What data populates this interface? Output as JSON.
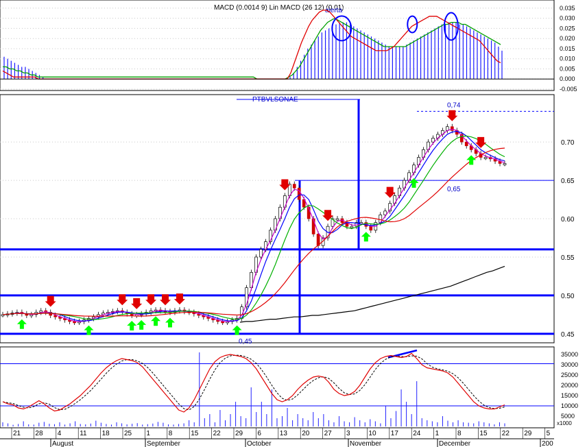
{
  "colors": {
    "background": "#ffffff",
    "grid": "#c8c8c8",
    "axis": "#000000",
    "level_line": "#0000ff",
    "ma_fast": "#c800c8",
    "ma_mid": "#0000ff",
    "ma_slow": "#00b000",
    "ma_long": "#e00000",
    "ma_200": "#000000",
    "signal_down": "#e00000",
    "signal_up": "#00ff00",
    "annotation": "#0000c8",
    "macd_hist": "#1a1aff",
    "macd_signal": "#00a000",
    "macd_line": "#e00000",
    "stoch_k": "#e00000",
    "stoch_d": "#000000",
    "volume": "#2020ff"
  },
  "macd_panel": {
    "title": "MACD (0.0014 9) Lin MACD (26 12) (0.01)",
    "label": "alerta",
    "y_ticks": [
      "0.035",
      "0.030",
      "0.025",
      "0.020",
      "0.015",
      "0.010",
      "0.005",
      "0.000",
      "-0.005"
    ]
  },
  "price_panel": {
    "title": "PTBVLSONAE",
    "y_ticks": [
      "0.70",
      "0.65",
      "0.60",
      "0.55",
      "0.50",
      "0.45"
    ],
    "annotations": [
      "0,74",
      "0,65",
      "0,45"
    ]
  },
  "osc_panel": {
    "y_ticks": [
      "35000",
      "30000",
      "25000",
      "20000",
      "15000",
      "10000",
      "5000"
    ],
    "unit": "x1000"
  },
  "x_axis": {
    "day_ticks": [
      "21",
      "28",
      "4",
      "11",
      "18",
      "25",
      "1",
      "8",
      "15",
      "22",
      "29",
      "6",
      "13",
      "20",
      "27",
      "3",
      "10",
      "17",
      "24",
      "1",
      "8",
      "15",
      "22",
      "29",
      "5"
    ],
    "months": [
      "August",
      "September",
      "October",
      "November",
      "December",
      "200"
    ]
  },
  "chart_data": [
    {
      "type": "bar",
      "name": "MACD",
      "ylim": [
        -0.005,
        0.037
      ],
      "histogram": [
        0.011,
        0.01,
        0.009,
        0.008,
        0.007,
        0.006,
        0.006,
        0.005,
        0.004,
        0.003,
        0.002,
        0.001,
        0.0,
        0.0,
        0.0,
        0.0,
        0.0,
        0.0,
        0.0,
        0.0,
        0.0,
        0.0,
        0.0,
        0.0,
        0.0,
        0.0,
        0.0,
        0.0,
        0.0,
        0.0,
        0.0,
        0.0,
        0.0,
        0.0,
        0.0,
        0.0,
        0.0,
        0.0,
        0.0,
        0.0,
        0.0,
        0.0,
        0.0,
        0.0,
        0.0,
        0.0,
        0.0,
        0.0,
        0.0,
        0.0,
        0.0,
        0.0,
        0.0,
        0.0,
        0.0,
        0.0,
        0.0,
        0.0,
        0.0,
        0.0,
        0.0,
        0.0,
        0.0,
        0.0,
        0.0,
        0.0,
        0.0,
        0.0,
        0.0,
        0.0,
        0.0,
        0.0,
        0.0,
        0.0,
        0.0,
        0.0,
        0.0,
        0.0,
        0.0,
        0.0,
        0.0,
        0.001,
        0.003,
        0.006,
        0.009,
        0.012,
        0.015,
        0.017,
        0.019,
        0.021,
        0.023,
        0.024,
        0.025,
        0.026,
        0.027,
        0.028,
        0.028,
        0.028,
        0.027,
        0.026,
        0.025,
        0.024,
        0.023,
        0.022,
        0.021,
        0.02,
        0.019,
        0.018,
        0.017,
        0.016,
        0.016,
        0.016,
        0.016,
        0.016,
        0.017,
        0.018,
        0.019,
        0.02,
        0.021,
        0.022,
        0.023,
        0.024,
        0.025,
        0.026,
        0.027,
        0.027,
        0.028,
        0.028,
        0.028,
        0.027,
        0.027,
        0.026,
        0.025,
        0.024,
        0.023,
        0.022,
        0.021,
        0.02,
        0.019,
        0.018,
        0.016,
        0.014
      ],
      "signal": [
        0.006,
        0.006,
        0.005,
        0.005,
        0.004,
        0.004,
        0.003,
        0.003,
        0.002,
        0.002,
        0.001,
        0.001,
        0.001,
        0.001,
        0.001,
        0.001,
        0.001,
        0.001,
        0.001,
        0.001,
        0.001,
        0.001,
        0.001,
        0.001,
        0.001,
        0.001,
        0.001,
        0.001,
        0.001,
        0.001,
        0.001,
        0.001,
        0.001,
        0.001,
        0.001,
        0.001,
        0.001,
        0.001,
        0.001,
        0.001,
        0.001,
        0.001,
        0.001,
        0.001,
        0.001,
        0.001,
        0.001,
        0.001,
        0.001,
        0.001,
        0.001,
        0.001,
        0.001,
        0.001,
        0.001,
        0.001,
        0.001,
        0.001,
        0.001,
        0.001,
        0.001,
        0.001,
        0.001,
        0.001,
        0.001,
        0.001,
        0.001,
        0.001,
        0.001,
        0.001,
        0.001,
        0.001,
        0.0,
        0.0,
        0.0,
        0.0,
        0.0,
        0.0,
        0.0,
        0.0,
        0.0,
        0.001,
        0.002,
        0.004,
        0.006,
        0.009,
        0.012,
        0.015,
        0.018,
        0.021,
        0.024,
        0.026,
        0.028,
        0.029,
        0.03,
        0.029,
        0.028,
        0.027,
        0.026,
        0.025,
        0.024,
        0.023,
        0.022,
        0.021,
        0.02,
        0.019,
        0.018,
        0.017,
        0.016,
        0.016,
        0.016,
        0.016,
        0.016,
        0.016,
        0.016,
        0.017,
        0.018,
        0.019,
        0.02,
        0.021,
        0.022,
        0.023,
        0.024,
        0.025,
        0.026,
        0.027,
        0.027,
        0.028,
        0.028,
        0.028,
        0.027,
        0.027,
        0.026,
        0.025,
        0.024,
        0.023,
        0.022,
        0.021,
        0.02,
        0.019,
        0.018,
        0.017
      ],
      "line": [
        0.004,
        0.003,
        0.002,
        0.001,
        0.001,
        0.001,
        0.001,
        0.001,
        0.001,
        0.001,
        0.0,
        0.0,
        0.0,
        0.0,
        0.0,
        0.0,
        0.0,
        0.0,
        0.0,
        0.0,
        0.0,
        0.0,
        0.0,
        0.0,
        0.0,
        0.0,
        0.0,
        0.0,
        0.0,
        0.0,
        0.0,
        0.0,
        0.0,
        0.0,
        0.0,
        0.0,
        0.0,
        0.0,
        0.0,
        0.0,
        0.0,
        0.0,
        0.0,
        0.0,
        0.0,
        0.0,
        0.0,
        0.0,
        0.0,
        0.0,
        0.0,
        0.0,
        0.0,
        0.0,
        0.0,
        0.0,
        0.0,
        0.0,
        0.0,
        0.0,
        0.0,
        0.0,
        0.0,
        0.0,
        0.0,
        0.0,
        0.0,
        0.0,
        0.0,
        0.0,
        0.0,
        0.0,
        0.0,
        0.0,
        0.0,
        0.0,
        0.0,
        0.0,
        0.0,
        0.0,
        0.0,
        0.003,
        0.008,
        0.013,
        0.018,
        0.022,
        0.026,
        0.029,
        0.031,
        0.033,
        0.034,
        0.034,
        0.033,
        0.031,
        0.029,
        0.027,
        0.025,
        0.023,
        0.021,
        0.02,
        0.019,
        0.018,
        0.017,
        0.016,
        0.015,
        0.014,
        0.014,
        0.014,
        0.014,
        0.015,
        0.016,
        0.018,
        0.02,
        0.022,
        0.024,
        0.026,
        0.027,
        0.028,
        0.029,
        0.03,
        0.031,
        0.031,
        0.031,
        0.03,
        0.029,
        0.028,
        0.027,
        0.026,
        0.025,
        0.024,
        0.023,
        0.022,
        0.021,
        0.02,
        0.019,
        0.017,
        0.015,
        0.013,
        0.011,
        0.009,
        0.008
      ],
      "highlight_circles": [
        32,
        74,
        98
      ]
    },
    {
      "type": "candlestick",
      "name": "PTBVLSONAE",
      "ylim": [
        0.44,
        0.76
      ],
      "close": [
        0.475,
        0.476,
        0.477,
        0.478,
        0.476,
        0.474,
        0.475,
        0.478,
        0.48,
        0.478,
        0.474,
        0.472,
        0.47,
        0.468,
        0.466,
        0.465,
        0.466,
        0.468,
        0.47,
        0.472,
        0.475,
        0.477,
        0.478,
        0.479,
        0.48,
        0.478,
        0.476,
        0.474,
        0.475,
        0.476,
        0.478,
        0.48,
        0.481,
        0.48,
        0.479,
        0.478,
        0.48,
        0.481,
        0.479,
        0.478,
        0.476,
        0.474,
        0.472,
        0.47,
        0.468,
        0.466,
        0.465,
        0.466,
        0.468,
        0.47,
        0.485,
        0.51,
        0.53,
        0.55,
        0.56,
        0.57,
        0.585,
        0.6,
        0.615,
        0.63,
        0.645,
        0.64,
        0.625,
        0.615,
        0.6,
        0.58,
        0.565,
        0.575,
        0.59,
        0.6,
        0.6,
        0.595,
        0.59,
        0.59,
        0.595,
        0.595,
        0.59,
        0.585,
        0.595,
        0.605,
        0.61,
        0.62,
        0.63,
        0.64,
        0.65,
        0.66,
        0.67,
        0.68,
        0.69,
        0.7,
        0.705,
        0.71,
        0.715,
        0.72,
        0.715,
        0.71,
        0.7,
        0.695,
        0.69,
        0.685,
        0.68,
        0.68,
        0.678,
        0.675,
        0.672,
        0.672
      ],
      "ma_200": [
        0.465,
        0.466,
        0.466,
        0.467,
        0.468,
        0.469,
        0.469,
        0.47,
        0.471,
        0.472,
        0.472,
        0.473,
        0.474,
        0.474,
        0.475,
        0.476,
        0.477,
        0.478,
        0.479,
        0.48,
        0.482,
        0.484,
        0.486,
        0.488,
        0.49,
        0.492,
        0.494,
        0.496,
        0.498,
        0.5,
        0.502,
        0.504,
        0.506,
        0.508,
        0.51,
        0.512,
        0.515,
        0.518,
        0.521,
        0.524,
        0.527,
        0.53,
        0.532,
        0.535,
        0.538
      ],
      "level_lines": [
        0.65,
        0.56,
        0.5,
        0.45
      ],
      "value_labels": [
        0.74,
        0.65,
        0.45
      ]
    },
    {
      "type": "line",
      "name": "Stochastic",
      "ylim": [
        0,
        38000
      ],
      "k": [
        12000,
        11000,
        10500,
        9000,
        8500,
        9500,
        11000,
        12500,
        11000,
        9000,
        7500,
        8000,
        9500,
        11000,
        13000,
        15000,
        17500,
        20000,
        23000,
        26000,
        28500,
        30500,
        32000,
        33000,
        32500,
        32000,
        31000,
        29000,
        26000,
        23000,
        20000,
        17000,
        14000,
        11000,
        8000,
        7000,
        9000,
        13000,
        18000,
        23000,
        28000,
        31500,
        33500,
        34500,
        35000,
        34500,
        34000,
        33000,
        31000,
        28000,
        24000,
        20000,
        16000,
        13000,
        12000,
        13000,
        15000,
        18000,
        20500,
        22500,
        24000,
        24500,
        24000,
        21500,
        18000,
        16000,
        15000,
        15500,
        17000,
        20000,
        24000,
        28000,
        31000,
        33000,
        34000,
        34500,
        34000,
        33500,
        34000,
        35500,
        33000,
        30000,
        28500,
        28000,
        27500,
        27000,
        26000,
        24000,
        21000,
        18000,
        15000,
        12000,
        10000,
        9000,
        8500,
        8500,
        9500,
        10500
      ],
      "volume": [
        2000,
        1500,
        800,
        1200,
        2500,
        1000,
        900,
        1800,
        2200,
        1300,
        1100,
        2000,
        900,
        1500,
        2500,
        1200,
        1000,
        1400,
        2800,
        1800,
        1200,
        900,
        2000,
        1500,
        1000,
        1300,
        1600,
        900,
        1100,
        1400,
        2200,
        1800,
        1000,
        900,
        1200,
        1500,
        3000,
        2000,
        36000,
        4000,
        6000,
        2000,
        8000,
        3000,
        6000,
        12000,
        5000,
        4000,
        19000,
        7000,
        12000,
        6000,
        18000,
        4000,
        5000,
        9000,
        3000,
        6000,
        4000,
        3000,
        7000,
        4000,
        6000,
        3000,
        2000,
        5000,
        2500,
        2000,
        4500,
        3000,
        2000,
        3500,
        2500,
        1500,
        10000,
        4000,
        7500,
        18000,
        12000,
        6000,
        22000,
        4000,
        3000,
        2500,
        2000,
        5000,
        2800,
        2000,
        3000,
        2000,
        1800,
        1500,
        2500,
        2000,
        1500,
        1000,
        2000,
        1500
      ]
    }
  ]
}
